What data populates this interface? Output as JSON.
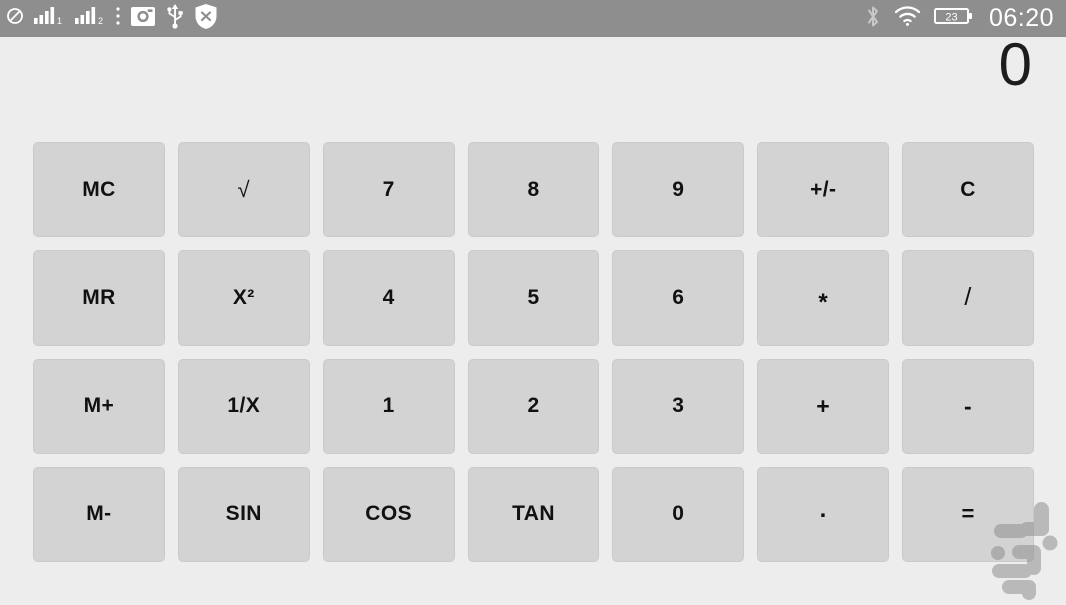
{
  "status_bar": {
    "left_icons": [
      {
        "name": "no-signal-icon",
        "glyph": "blocked"
      },
      {
        "name": "signal-bars-sim1-icon",
        "label": "1"
      },
      {
        "name": "signal-bars-sim2-icon",
        "label": "2"
      },
      {
        "name": "more-options-icon",
        "glyph": "vertical-dots"
      },
      {
        "name": "camera-icon",
        "glyph": "camera"
      },
      {
        "name": "usb-icon",
        "glyph": "usb"
      },
      {
        "name": "shield-close-icon",
        "glyph": "shield-x"
      }
    ],
    "right_icons": [
      {
        "name": "bluetooth-icon",
        "glyph": "bluetooth"
      },
      {
        "name": "wifi-icon",
        "glyph": "wifi"
      },
      {
        "name": "battery-icon",
        "glyph": "battery",
        "level": "23"
      }
    ],
    "battery_level": "23",
    "clock": "06:20"
  },
  "display": {
    "value": "0"
  },
  "keypad": {
    "rows": [
      [
        {
          "key": "mc",
          "label": "MC"
        },
        {
          "key": "sqrt",
          "label": "√"
        },
        {
          "key": "7",
          "label": "7"
        },
        {
          "key": "8",
          "label": "8"
        },
        {
          "key": "9",
          "label": "9"
        },
        {
          "key": "sign",
          "label": "+/-"
        },
        {
          "key": "c",
          "label": "C"
        }
      ],
      [
        {
          "key": "mr",
          "label": "MR"
        },
        {
          "key": "square",
          "label": "X²"
        },
        {
          "key": "4",
          "label": "4"
        },
        {
          "key": "5",
          "label": "5"
        },
        {
          "key": "6",
          "label": "6"
        },
        {
          "key": "mul",
          "label": "*"
        },
        {
          "key": "div",
          "label": "/"
        }
      ],
      [
        {
          "key": "mplus",
          "label": "M+"
        },
        {
          "key": "inverse",
          "label": "1/X"
        },
        {
          "key": "1",
          "label": "1"
        },
        {
          "key": "2",
          "label": "2"
        },
        {
          "key": "3",
          "label": "3"
        },
        {
          "key": "add",
          "label": "+"
        },
        {
          "key": "sub",
          "label": "-"
        }
      ],
      [
        {
          "key": "mminus",
          "label": "M-"
        },
        {
          "key": "sin",
          "label": "SIN"
        },
        {
          "key": "cos",
          "label": "COS"
        },
        {
          "key": "tan",
          "label": "TAN"
        },
        {
          "key": "0",
          "label": "0"
        },
        {
          "key": "dot",
          "label": "."
        },
        {
          "key": "equals",
          "label": "="
        }
      ]
    ]
  },
  "watermark": {
    "name": "app-logo-watermark"
  },
  "colors": {
    "status_bar_bg": "#8e8e8e",
    "page_bg": "#ededed",
    "key_bg": "#d3d3d3",
    "key_border": "#cacaca",
    "text": "#111111",
    "display_text": "#1d1d1d",
    "status_icon": "#ffffff",
    "watermark": "#9a9a9a"
  }
}
